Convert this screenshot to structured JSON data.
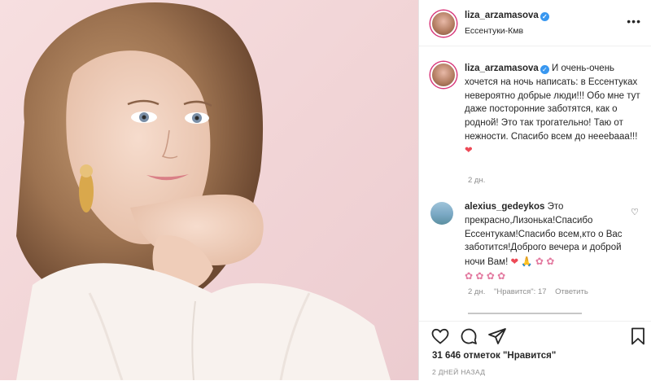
{
  "post": {
    "username": "liza_arzamasova",
    "location": "Ессентуки-Кмв",
    "caption_text": "И очень-очень хочется на ночь написать: в Ессентуках невероятно добрые люди!!! Обо мне тут даже посторонние заботятся, как о родной! Это так трогательно! Таю от нежности. Спасибо всем до неееbааа!!!",
    "caption_emoji": "❤",
    "caption_age": "2 дн.",
    "likes": "31 646 отметок \"Нравится\"",
    "time_ago": "2 ДНЕЙ НАЗАД"
  },
  "comments": [
    {
      "username": "alexius_gedeykos",
      "text": "Это прекрасно,Лизонька!Спасибо Ессентукам!Спасибо всем,кто о Вас заботится!Доброго вечера и доброй ночи Вам!",
      "emoji_a": "❤",
      "emoji_b": "🙏",
      "emoji_c": "✿ ✿",
      "emoji_d": "✿ ✿ ✿ ✿",
      "age": "2 дн.",
      "likes": "\"Нравится\": 17",
      "reply": "Ответить"
    }
  ],
  "icons": {
    "more": "more-dots-icon",
    "like": "heart-icon",
    "comment": "comment-icon",
    "share": "share-icon",
    "save": "bookmark-icon",
    "verified": "verified-badge-icon"
  },
  "colors": {
    "verified": "#3897f0",
    "heart": "#ed4956",
    "meta_text": "#8e8e8e"
  }
}
